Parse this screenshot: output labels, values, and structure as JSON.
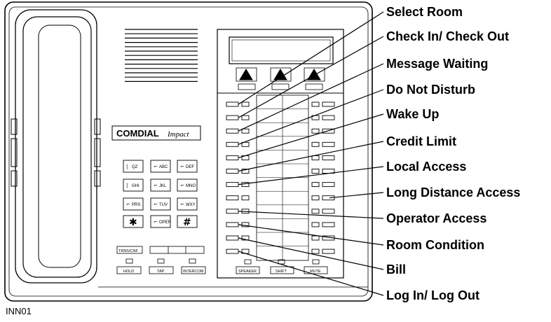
{
  "brand": {
    "logo_text": "COMDIAL",
    "logo_script": "Impact"
  },
  "keypad": [
    {
      "glyph": "|",
      "text": "QZ"
    },
    {
      "glyph": "⌐",
      "text": "ABC"
    },
    {
      "glyph": "⌐",
      "text": "DEF"
    },
    {
      "glyph": "|",
      "text": "GHI"
    },
    {
      "glyph": "⌐",
      "text": "JKL"
    },
    {
      "glyph": "⌐",
      "text": "MNO"
    },
    {
      "glyph": "⌐",
      "text": "PRS"
    },
    {
      "glyph": "⌐",
      "text": "TUV"
    },
    {
      "glyph": "⌐",
      "text": "WXY"
    },
    {
      "glyph": "✱",
      "text": ""
    },
    {
      "glyph": "⌐",
      "text": "OPER"
    },
    {
      "glyph": "#",
      "text": ""
    }
  ],
  "bottom_left": {
    "trns_label": "TRNS/CNF",
    "hold": "HOLD",
    "tap": "TAP",
    "intercom": "INTERCOM"
  },
  "bottom_right": {
    "speaker": "SPEAKER",
    "shift": "SHIFT",
    "mute": "MUTE"
  },
  "callouts": [
    "Select Room",
    "Check In/ Check Out",
    "Message Waiting",
    "Do Not Disturb",
    "Wake Up",
    "Credit Limit",
    "Local Access",
    "Long Distance Access",
    "Operator Access",
    "Room Condition",
    "Bill",
    "Log In/ Log Out"
  ],
  "figure_id": "INN01"
}
